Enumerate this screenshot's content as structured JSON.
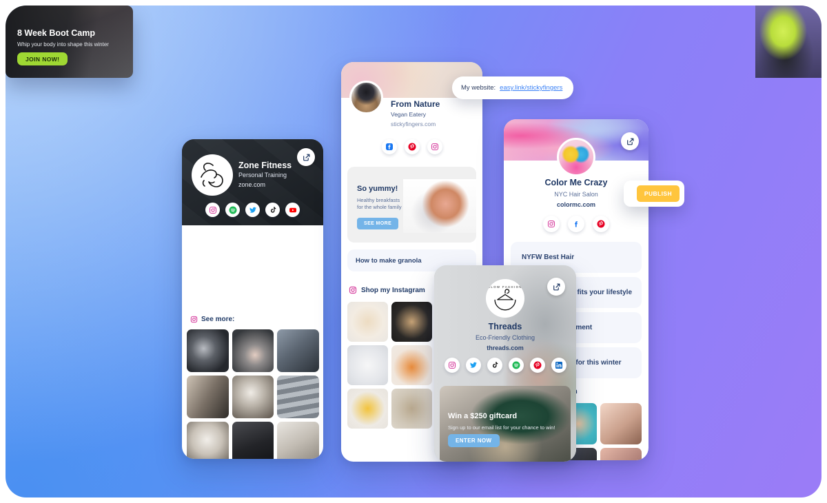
{
  "background": {
    "gradient_from": "#b9d5fb",
    "gradient_mid": "#4a90f2",
    "gradient_to": "#9b7cf7",
    "page_background": "#ffffff"
  },
  "cards": {
    "zone_fitness": {
      "name": "Zone Fitness",
      "tagline": "Personal Training",
      "website": "zone.com",
      "avatar_icon": "flexed-biceps-logo",
      "share_icon": "share-icon",
      "socials": [
        "instagram",
        "spotify",
        "twitter",
        "tiktok",
        "youtube"
      ],
      "see_more_label": "See more:",
      "see_more_icon": "instagram-icon",
      "photos": 9
    },
    "boot_camp_promo": {
      "title": "8 Week Boot Camp",
      "subtitle": "Whip your body into shape this winter",
      "button_label": "JOIN NOW!",
      "button_color": "#9fd833"
    },
    "from_nature": {
      "name": "From Nature",
      "tagline": "Vegan Eatery",
      "website": "stickyfingers.com",
      "avatar_icon": "profile-photo",
      "socials": [
        "facebook",
        "pinterest",
        "instagram"
      ],
      "promo": {
        "title": "So yummy!",
        "subtitle_line1": "Healthy breakfasts",
        "subtitle_line2": "for the whole family",
        "button_label": "SEE MORE",
        "button_color": "#74b4e8"
      },
      "link_card": "How to make granola",
      "shop_label": "Shop my Instagram",
      "shop_icon": "instagram-icon",
      "photos": 9
    },
    "website_tooltip": {
      "label": "My website:",
      "link_text": "easy.link/stickyfingers",
      "link_color": "#3b82f6"
    },
    "color_me_crazy": {
      "name": "Color Me Crazy",
      "tagline": "NYC Hair Salon",
      "website": "colormc.com",
      "avatar_icon": "profile-photo",
      "share_icon": "share-icon",
      "socials": [
        "instagram",
        "facebook",
        "pinterest"
      ],
      "link_cards": [
        "NYFW Best Hair",
        "Find the cut that fits your lifestyle",
        "Book an appointment",
        "Best hair colors for this winter"
      ],
      "shop_label": "Shop my Instagram",
      "photos": 6
    },
    "publish": {
      "button_label": "PUBLISH",
      "button_color": "#ffc53d"
    },
    "threads": {
      "name": "Threads",
      "tagline": "Eco-Friendly Clothing",
      "website": "threads.com",
      "avatar_icon": "slow-fashion-hanger-logo",
      "avatar_text": "SLOW FASHION",
      "share_icon": "share-icon",
      "socials": [
        "instagram",
        "twitter",
        "tiktok",
        "spotify",
        "pinterest",
        "linkedin"
      ],
      "promo": {
        "title": "Win a $250 giftcard",
        "subtitle": "Sign up to our email list for your chance to win!",
        "button_label": "ENTER NOW",
        "button_color": "#74b4e8"
      }
    }
  }
}
